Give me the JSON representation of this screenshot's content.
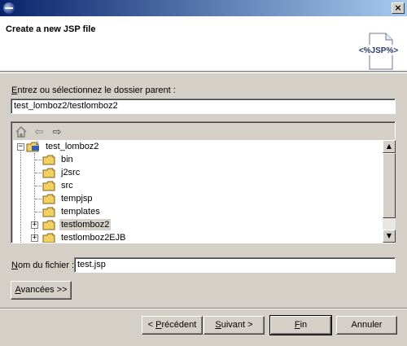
{
  "window": {
    "close_glyph": "×"
  },
  "header": {
    "title": "Create a new JSP file",
    "banner_text": "<%JSP%>"
  },
  "parent_folder": {
    "label_first": "E",
    "label_rest": "ntrez ou sélectionnez le dossier parent :",
    "value": "test_lomboz2/testlomboz2"
  },
  "tree": {
    "toolbar": {
      "home_icon": "home-icon",
      "back_glyph": "⇦",
      "forward_glyph": "⇨"
    },
    "project": {
      "expander": "−",
      "label": "test_lomboz2"
    },
    "folders": [
      {
        "label": "bin",
        "expander": ""
      },
      {
        "label": "j2src",
        "expander": ""
      },
      {
        "label": "src",
        "expander": ""
      },
      {
        "label": "tempjsp",
        "expander": ""
      },
      {
        "label": "templates",
        "expander": ""
      },
      {
        "label": "testlomboz2",
        "expander": "+",
        "selected": true
      },
      {
        "label": "testlomboz2EJB",
        "expander": "+"
      }
    ],
    "scroll_up": "▲",
    "scroll_down": "▼"
  },
  "file_name": {
    "label_first": "N",
    "label_rest": "om du fichier :",
    "value": "test.jsp"
  },
  "advanced_button": {
    "first": "A",
    "rest": "vancées >>"
  },
  "footer": {
    "back": {
      "prefix": "< ",
      "first": "P",
      "rest": "récédent"
    },
    "next": {
      "first": "S",
      "rest": "uivant >"
    },
    "finish": {
      "first": "F",
      "rest": "in"
    },
    "cancel": "Annuler"
  },
  "colors": {
    "titlebar": "#0a246a",
    "folder": "#f0d060",
    "selection": "#d4d0c8"
  }
}
